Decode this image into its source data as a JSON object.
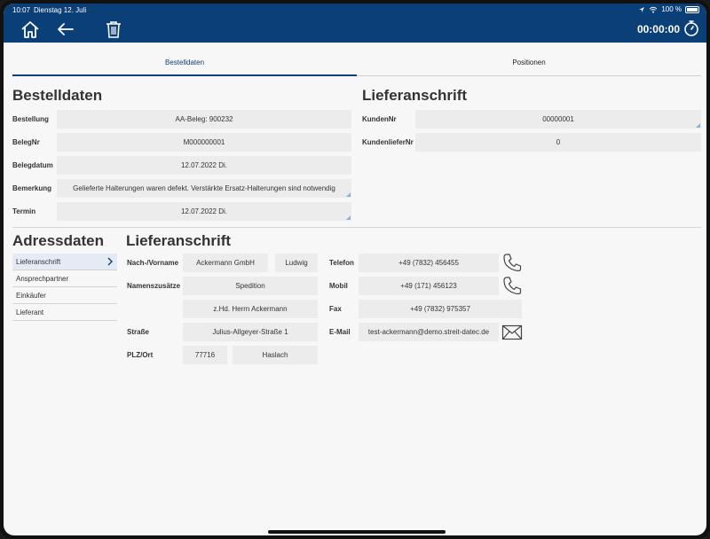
{
  "status": {
    "time": "10:07",
    "date": "Dienstag 12. Juli",
    "battery": "100 %"
  },
  "toolbar": {
    "timer": "00:00:00"
  },
  "tabs": [
    {
      "label": "Bestelldaten"
    },
    {
      "label": "Positionen"
    }
  ],
  "bestelldaten": {
    "heading": "Bestelldaten",
    "fields": [
      {
        "label": "Bestellung",
        "value": "AA-Beleg: 900232"
      },
      {
        "label": "BelegNr",
        "value": "M000000001"
      },
      {
        "label": "Belegdatum",
        "value": "12.07.2022 Di."
      },
      {
        "label": "Bemerkung",
        "value": "Gelieferte Halterungen waren defekt. Verstärkte Ersatz-Halterungen sind notwendig"
      },
      {
        "label": "Termin",
        "value": "12.07.2022 Di."
      }
    ]
  },
  "lieferanschrift_top": {
    "heading": "Lieferanschrift",
    "fields": [
      {
        "label": "KundenNr",
        "value": "00000001"
      },
      {
        "label": "KundenlieferNr",
        "value": "0"
      }
    ]
  },
  "adressdaten": {
    "heading": "Adressdaten",
    "nav": [
      {
        "label": "Lieferanschrift"
      },
      {
        "label": "Ansprechpartner"
      },
      {
        "label": "Einkäufer"
      },
      {
        "label": "Lieferant"
      }
    ]
  },
  "address": {
    "heading": "Lieferanschrift",
    "name_label": "Nach-/Vorname",
    "last_name": "Ackermann GmbH",
    "first_name": "Ludwig",
    "zusatz_label": "Namenszusätze",
    "zusatz1": "Spedition",
    "zusatz2": "z.Hd. Herrn Ackermann",
    "street_label": "Straße",
    "street": "Julius-Allgeyer-Straße 1",
    "city_label": "PLZ/Ort",
    "zip": "77716",
    "city": "Haslach",
    "phone_label": "Telefon",
    "phone": "+49 (7832) 456455",
    "mobile_label": "Mobil",
    "mobile": "+49 (171) 456123",
    "fax_label": "Fax",
    "fax": "+49 (7832) 975357",
    "email_label": "E-Mail",
    "email": "test-ackermann@demo.streit-datec.de"
  },
  "icons": {
    "home": "home-icon",
    "back": "arrow-left-icon",
    "delete": "trash-icon",
    "timer": "stopwatch-icon",
    "phone": "phone-icon",
    "mail": "mail-icon"
  },
  "colors": {
    "header": "#0b3f78",
    "field": "#ececec"
  }
}
